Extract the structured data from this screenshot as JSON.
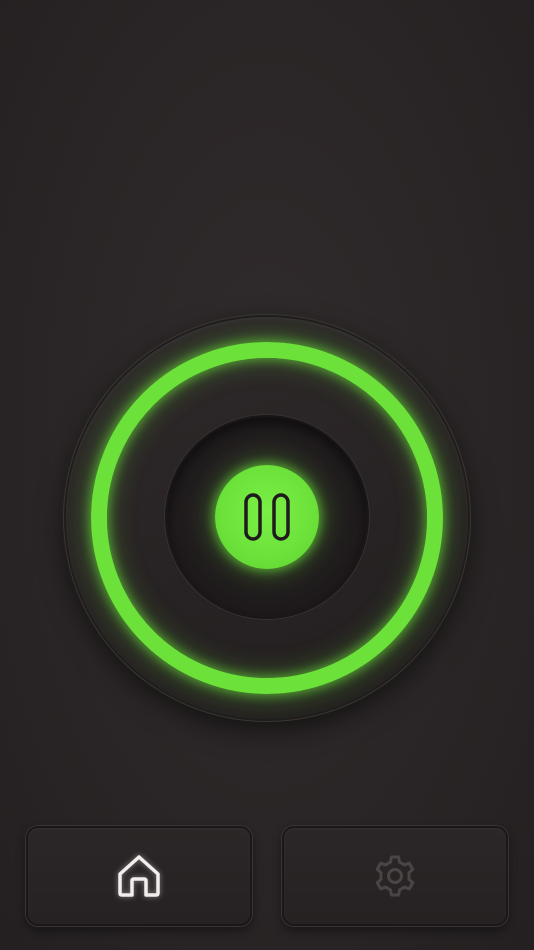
{
  "app": {
    "state": "playing",
    "accent_color": "#6be13a",
    "background_color": "#2a2526"
  },
  "dial": {
    "center_control": {
      "icon": "pause-icon",
      "color": "#6be13a"
    },
    "ring_color": "#6be13a"
  },
  "bottom_bar": {
    "home": {
      "icon": "home-icon",
      "active": true,
      "color": "#f2eeee"
    },
    "settings": {
      "icon": "gear-icon",
      "active": false,
      "color": "#4a4445"
    }
  }
}
